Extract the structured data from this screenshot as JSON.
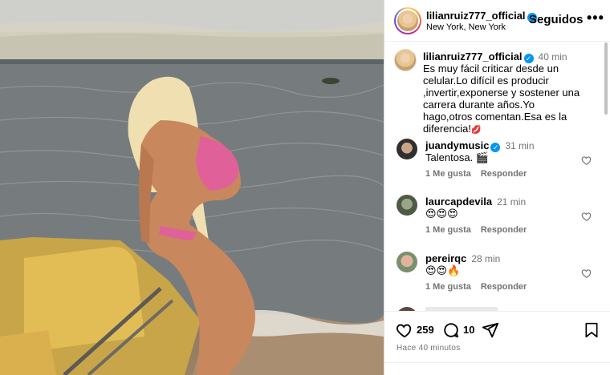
{
  "post": {
    "username": "lilianruiz777_official",
    "location": "New York, New York",
    "follow_label": "Seguidos",
    "more_label": "•••",
    "caption_time": "40 min",
    "caption": "Es muy fácil criticar desde un celular.Lo difícil es producir ,invertir,exponerse y sostener una carrera durante años.Yo hago,otros comentan.Esa es la diferencia!",
    "caption_emoji": "💋",
    "verified_mark": "✓"
  },
  "comments": [
    {
      "username": "juandymusic",
      "verified": true,
      "time": "31 min",
      "text": "Talentosa. 🎬",
      "likes_label": "1 Me gusta",
      "reply_label": "Responder",
      "avatar_color": "#3a3a3a"
    },
    {
      "username": "laurcapdevila",
      "verified": false,
      "time": "21 min",
      "text": "😍😍😍",
      "likes_label": "1 Me gusta",
      "reply_label": "Responder",
      "avatar_color": "#6d7f63"
    },
    {
      "username": "pereirqc",
      "verified": false,
      "time": "28 min",
      "text": "😍😍🔥",
      "likes_label": "1 Me gusta",
      "reply_label": "Responder",
      "avatar_color": "#d9a48a"
    }
  ],
  "footer": {
    "likes_count": "259",
    "comments_count": "10",
    "date": "Hace 40 minutos"
  },
  "icons": {
    "like": "heart-icon",
    "comment": "comment-icon",
    "share": "send-icon",
    "save": "bookmark-icon",
    "comment_like": "heart-outline-icon"
  },
  "colors": {
    "verified": "#0095f6",
    "secondary_text": "#737373",
    "border": "#dbdbdb"
  }
}
